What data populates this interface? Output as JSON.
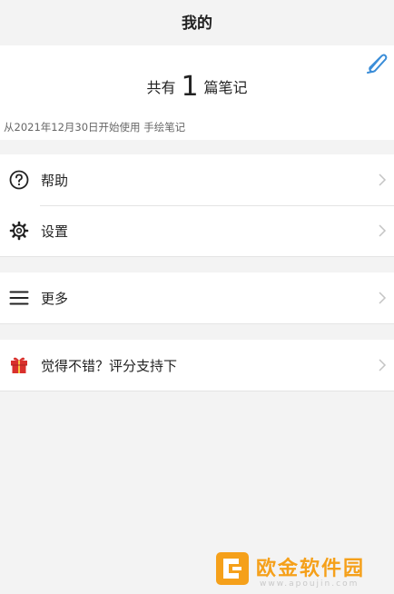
{
  "header": {
    "title": "我的"
  },
  "summary": {
    "prefix": "共有",
    "count": "1",
    "suffix": "篇笔记",
    "since": "从2021年12月30日开始使用 手绘笔记",
    "edit_icon": "pen-edit-icon"
  },
  "menu": {
    "help": {
      "label": "帮助",
      "icon": "help-circle-icon"
    },
    "settings": {
      "label": "设置",
      "icon": "gear-icon"
    },
    "more": {
      "label": "更多",
      "icon": "hamburger-menu-icon"
    },
    "rate": {
      "label": "觉得不错？评分支持下",
      "icon": "gift-icon"
    }
  },
  "watermark": {
    "text": "欧金软件园",
    "url": "www.apoujin.com"
  },
  "colors": {
    "background": "#f3f3f3",
    "card": "#ffffff",
    "edit_accent": "#3a8dd8",
    "gift_red": "#d9302c",
    "watermark_orange": "#f5a01a"
  }
}
